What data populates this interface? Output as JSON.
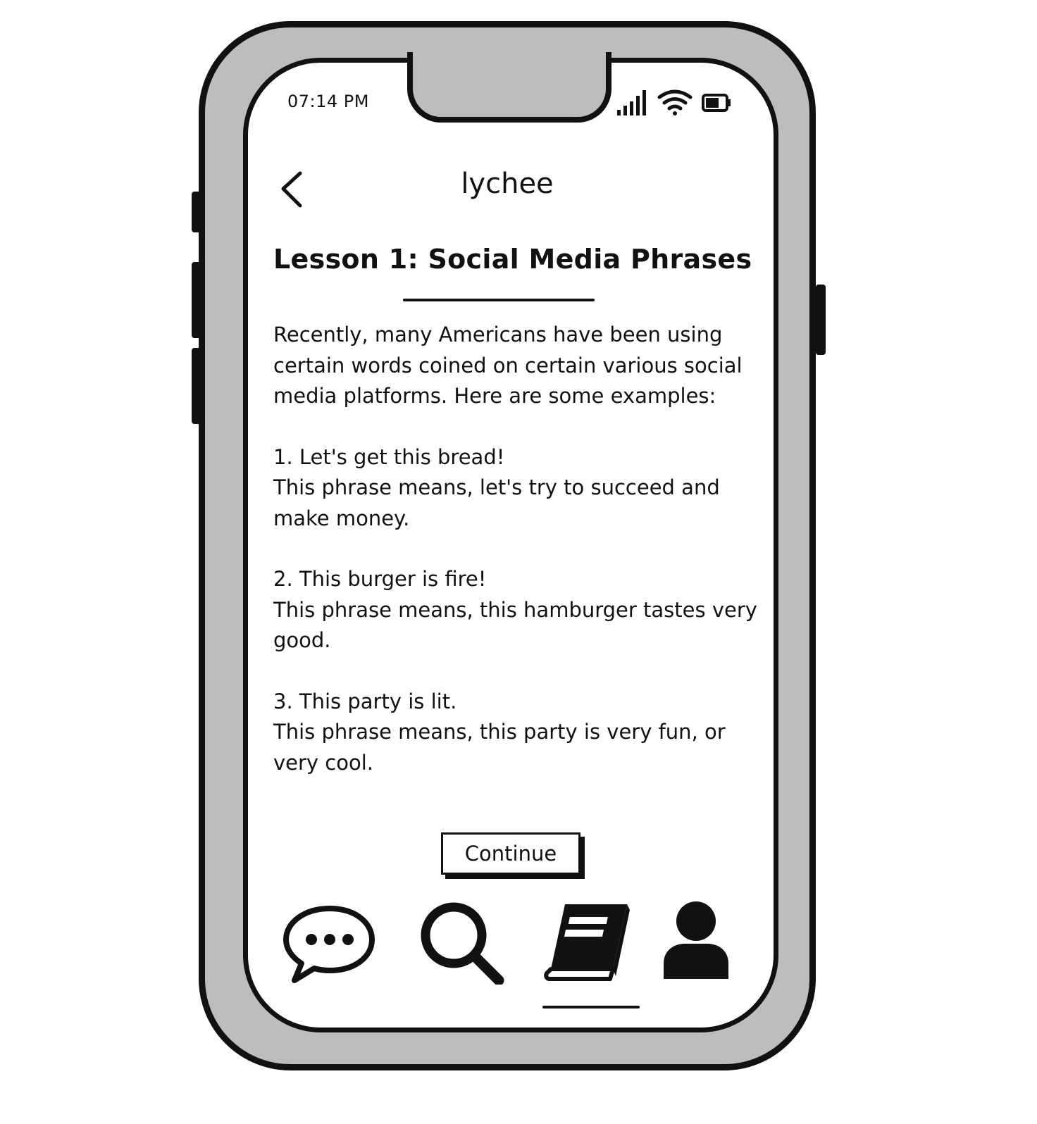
{
  "status_bar": {
    "time": "07:14 PM",
    "icons": [
      "signal-icon",
      "wifi-icon",
      "battery-icon"
    ]
  },
  "header": {
    "app_title": "lychee",
    "back_icon": "chevron-left-icon"
  },
  "lesson": {
    "title": "Lesson 1: Social Media Phrases",
    "intro": "Recently, many Americans have been using certain words coined on certain various social media platforms. Here are some examples:",
    "phrases": [
      {
        "phrase": "1. Let's get this bread!",
        "meaning": "This phrase means, let's try to succeed and make money."
      },
      {
        "phrase": "2. This burger is fire!",
        "meaning": "This phrase means, this hamburger tastes very good."
      },
      {
        "phrase": "3. This party is lit.",
        "meaning": "This phrase means, this party is very fun, or very cool."
      }
    ]
  },
  "continue_button": {
    "label": "Continue"
  },
  "bottom_nav": {
    "items": [
      {
        "icon": "chat-bubble-icon",
        "active": false
      },
      {
        "icon": "search-icon",
        "active": false
      },
      {
        "icon": "book-icon",
        "active": true
      },
      {
        "icon": "user-icon",
        "active": false
      }
    ]
  },
  "colors": {
    "frame": "#111111",
    "bezel": "#bdbdbd",
    "screen": "#ffffff",
    "text": "#111111"
  }
}
